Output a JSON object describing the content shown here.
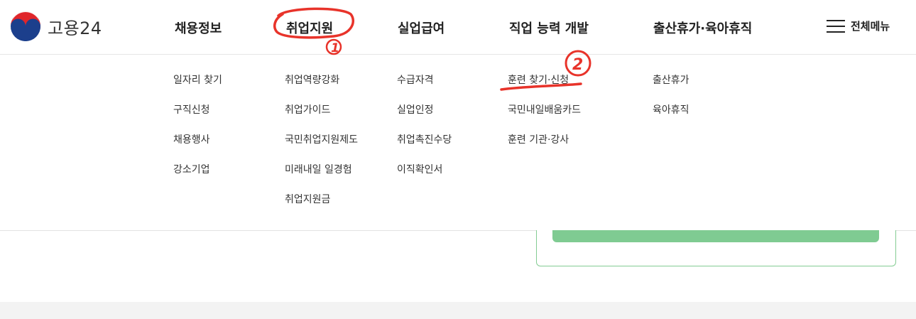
{
  "header": {
    "logo_text": "고용24",
    "nav": [
      {
        "label": "채용정보"
      },
      {
        "label": "취업지원"
      },
      {
        "label": "실업급여"
      },
      {
        "label": "직업 능력 개발"
      },
      {
        "label": "출산휴가·육아휴직"
      }
    ],
    "all_menu_label": "전체메뉴"
  },
  "submenu": {
    "col0": [
      "일자리 찾기",
      "구직신청",
      "채용행사",
      "강소기업"
    ],
    "col1": [
      "취업역량강화",
      "취업가이드",
      "국민취업지원제도",
      "미래내일 일경험",
      "취업지원금"
    ],
    "col2": [
      "수급자격",
      "실업인정",
      "취업촉진수당",
      "이직확인서"
    ],
    "col3": [
      "훈련 찾기·신청",
      "국민내일배움카드",
      "훈련 기관·강사"
    ],
    "col4": [
      "출산휴가",
      "육아휴직"
    ]
  },
  "annotations": {
    "mark1": "1",
    "mark2": "2",
    "color": "#e8332a"
  },
  "colors": {
    "accent_green": "#7fcb92",
    "annotation_red": "#e8332a"
  }
}
